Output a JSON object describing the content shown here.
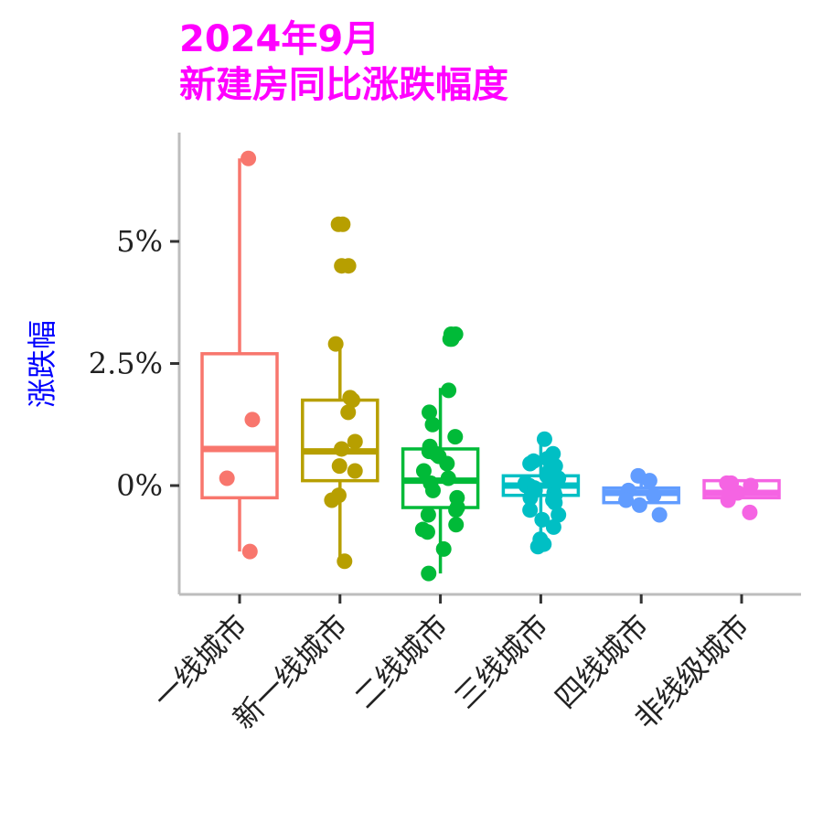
{
  "chart_data": {
    "type": "box",
    "title_lines": [
      "2024年9月",
      "新建房同比涨跌幅度"
    ],
    "ylabel": "涨跌幅",
    "xlabel": "",
    "yticks": [
      {
        "value": 0,
        "label": "0%"
      },
      {
        "value": 2.5,
        "label": "2.5%"
      },
      {
        "value": 5,
        "label": "5%"
      }
    ],
    "ylim": [
      -2.3,
      7.2
    ],
    "grid": false,
    "legend": "none",
    "categories": [
      "一线城市",
      "新一线城市",
      "二线城市",
      "三线城市",
      "四线城市",
      "非线级城市"
    ],
    "colors": [
      "#f8766d",
      "#b79f00",
      "#00ba38",
      "#00bfc4",
      "#619cff",
      "#f564e3"
    ],
    "series": [
      {
        "category": "一线城市",
        "box": {
          "lower_whisker": -1.35,
          "q1": -0.25,
          "median": 0.75,
          "q3": 2.7,
          "upper_whisker": 6.7
        },
        "points": [
          6.7,
          1.35,
          0.15,
          -1.35
        ]
      },
      {
        "category": "新一线城市",
        "box": {
          "lower_whisker": -1.55,
          "q1": 0.1,
          "median": 0.7,
          "q3": 1.75,
          "upper_whisker": 2.9
        },
        "points": [
          5.35,
          5.35,
          4.5,
          4.5,
          2.9,
          1.8,
          1.75,
          1.5,
          0.9,
          0.75,
          0.4,
          0.3,
          -0.2,
          -0.3,
          -1.55
        ]
      },
      {
        "category": "二线城市",
        "box": {
          "lower_whisker": -1.8,
          "q1": -0.45,
          "median": 0.1,
          "q3": 0.75,
          "upper_whisker": 2.0
        },
        "points": [
          3.1,
          3.1,
          3.0,
          3.0,
          1.95,
          1.5,
          1.25,
          1.0,
          0.8,
          0.7,
          0.65,
          0.6,
          0.45,
          0.3,
          0.15,
          0.05,
          -0.1,
          -0.25,
          -0.45,
          -0.5,
          -0.6,
          -0.8,
          -0.9,
          -0.95,
          -1.3,
          -1.8
        ]
      },
      {
        "category": "三线城市",
        "box": {
          "lower_whisker": -1.25,
          "q1": -0.2,
          "median": 0.0,
          "q3": 0.2,
          "upper_whisker": 0.95
        },
        "points": [
          0.95,
          0.65,
          0.6,
          0.55,
          0.5,
          0.45,
          0.4,
          0.35,
          0.3,
          0.25,
          0.2,
          0.15,
          0.1,
          0.05,
          0.0,
          0.0,
          -0.05,
          -0.1,
          -0.15,
          -0.2,
          -0.25,
          -0.3,
          -0.35,
          -0.5,
          -0.6,
          -0.7,
          -0.85,
          -1.1,
          -1.2,
          -1.25
        ]
      },
      {
        "category": "四线城市",
        "box": {
          "lower_whisker": -0.35,
          "q1": -0.35,
          "median": -0.15,
          "q3": -0.05,
          "upper_whisker": 0.2
        },
        "points": [
          0.2,
          0.1,
          -0.1,
          -0.2,
          -0.3,
          -0.4,
          -0.6
        ]
      },
      {
        "category": "非线级城市",
        "box": {
          "lower_whisker": -0.25,
          "q1": -0.25,
          "median": -0.15,
          "q3": 0.1,
          "upper_whisker": 0.1
        },
        "points": [
          0.05,
          0.05,
          0.0,
          -0.15,
          -0.3,
          -0.55
        ]
      }
    ]
  }
}
